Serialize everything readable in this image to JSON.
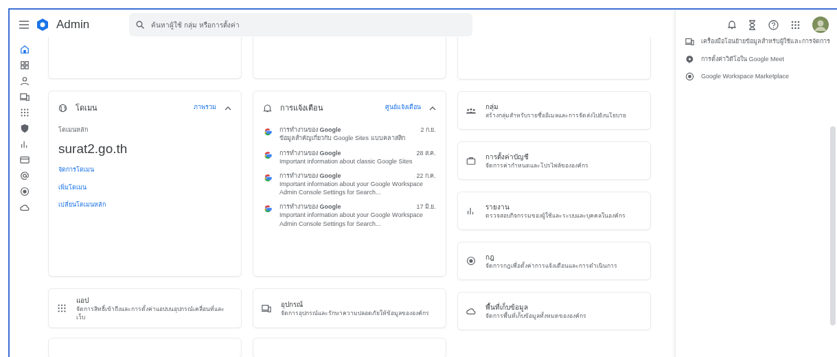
{
  "header": {
    "app_name": "Admin",
    "search": {
      "placeholder": "ค้นหาผู้ใช้ กลุ่ม หรือการตั้งค่า"
    }
  },
  "sidebar": {
    "items": [
      {
        "kind": "home",
        "selected": true
      },
      {
        "kind": "dashboard",
        "selected": false
      },
      {
        "kind": "user",
        "selected": false
      },
      {
        "kind": "devices",
        "selected": false
      },
      {
        "kind": "apps",
        "selected": false
      },
      {
        "kind": "shield",
        "selected": false
      },
      {
        "kind": "reports",
        "selected": false
      },
      {
        "kind": "billing",
        "selected": false
      },
      {
        "kind": "at",
        "selected": false
      },
      {
        "kind": "rules",
        "selected": false
      },
      {
        "kind": "cloud",
        "selected": false
      }
    ]
  },
  "domain_card": {
    "title": "โดเมน",
    "link": "ภาพรวม",
    "expanded": true,
    "label": "โดเมนหลัก",
    "domain": "surat2.go.th",
    "actions": [
      "จัดการโดเมน",
      "เพิ่มโดเมน",
      "เปลี่ยนโดเมนหลัก"
    ]
  },
  "alerts_card": {
    "title": "การแจ้งเตือน",
    "link": "ศูนย์แจ้งเตือน",
    "expanded": true,
    "items": [
      {
        "sender": "การทำงานของ **Google**",
        "date": "2 ก.ย.",
        "message": "ข้อมูลสำคัญเกี่ยวกับ Google Sites แบบคลาสสิก"
      },
      {
        "sender": "การทำงานของ **Google**",
        "date": "28 ส.ค.",
        "message": "Important information about classic Google Sites"
      },
      {
        "sender": "การทำงานของ **Google**",
        "date": "22 ก.ค.",
        "message": "Important information about your Google Workspace Admin Console Settings for Search..."
      },
      {
        "sender": "การทำงานของ **Google**",
        "date": "17 มิ.ย.",
        "message": "Important information about your Google Workspace Admin Console Settings for Search..."
      }
    ]
  },
  "shortcut_cards": [
    {
      "kind": "groups",
      "title": "กลุ่ม",
      "description": "สร้างกลุ่มสำหรับรายชื่ออีเมลและการจัดส่งไปยังนโยบาย"
    },
    {
      "kind": "account",
      "title": "การตั้งค่าบัญชี",
      "description": "จัดการค่ากำหนดและโปรไฟล์ขององค์กร"
    },
    {
      "kind": "reports",
      "title": "รายงาน",
      "description": "ตรวจสอบกิจกรรมของผู้ใช้และระบบและบุคคลในองค์กร"
    },
    {
      "kind": "rules",
      "title": "กฎ",
      "description": "จัดการกฎเพื่อตั้งค่าการแจ้งเตือนและการดำเนินการ"
    },
    {
      "kind": "cloud",
      "title": "พื้นที่เก็บข้อมูล",
      "description": "จัดการพื้นที่เก็บข้อมูลทั้งหมดขององค์กร"
    }
  ],
  "bottom_cards": [
    {
      "kind": "apps",
      "title": "แอป",
      "description": "จัดการสิทธิ์เข้าถึงและการตั้งค่าแอปบนอุปกรณ์เคลื่อนที่และเว็บ"
    },
    {
      "kind": "devices",
      "title": "อุปกรณ์",
      "description": "จัดการอุปกรณ์และรักษาความปลอดภัยให้ข้อมูลขององค์กร"
    }
  ],
  "side_panel": {
    "items": [
      {
        "kind": "devices",
        "label": "เครื่องมือโอนย้ายข้อมูลสำหรับผู้ใช้และการจัดการ"
      },
      {
        "kind": "meet",
        "label": "การตั้งค่าวิดีโอใน Google Meet"
      },
      {
        "kind": "marketplace",
        "label": "Google Workspace Marketplace"
      }
    ]
  }
}
